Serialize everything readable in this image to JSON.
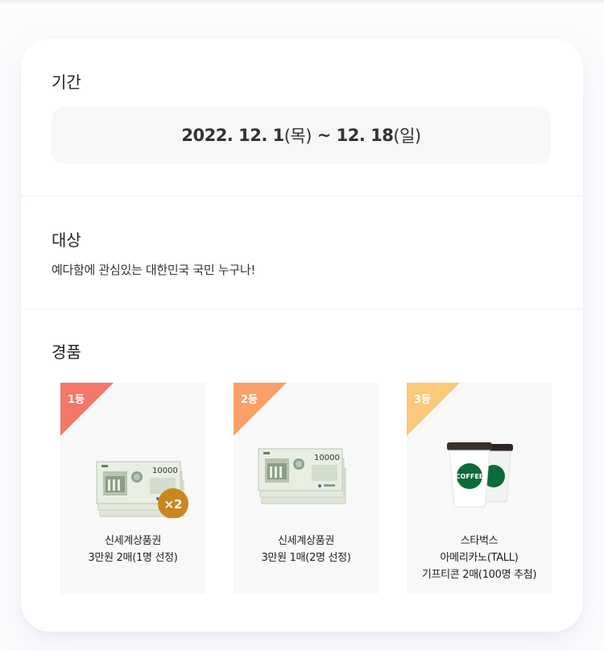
{
  "period": {
    "heading": "기간",
    "date_start": "2022. 12. 1",
    "day_start": "(목)",
    "separator": " ~ ",
    "date_end": "12. 18",
    "day_end": "(일)"
  },
  "target": {
    "heading": "대상",
    "text": "예다함에 관심있는 대한민국 국민 누구나!"
  },
  "prizes": {
    "heading": "경품",
    "items": [
      {
        "rank": "1등",
        "lines": [
          "신세계상품권",
          "3만원 2매(1명 선정)"
        ],
        "badge": "×2",
        "ticket_amount": "10000"
      },
      {
        "rank": "2등",
        "lines": [
          "신세계상품권",
          "3만원 1매(2명 선정)"
        ],
        "ticket_amount": "10000"
      },
      {
        "rank": "3등",
        "lines": [
          "스타벅스",
          "아메리카노(TALL)",
          "기프티콘 2매(100명 추첨)"
        ],
        "cup_label": "COFFEE"
      }
    ]
  },
  "colors": {
    "rank1": "#f4776a",
    "rank2": "#f8a066",
    "rank3": "#fbc97a",
    "badge": "#c9861f",
    "starbucks_green": "#0b6b3a"
  }
}
